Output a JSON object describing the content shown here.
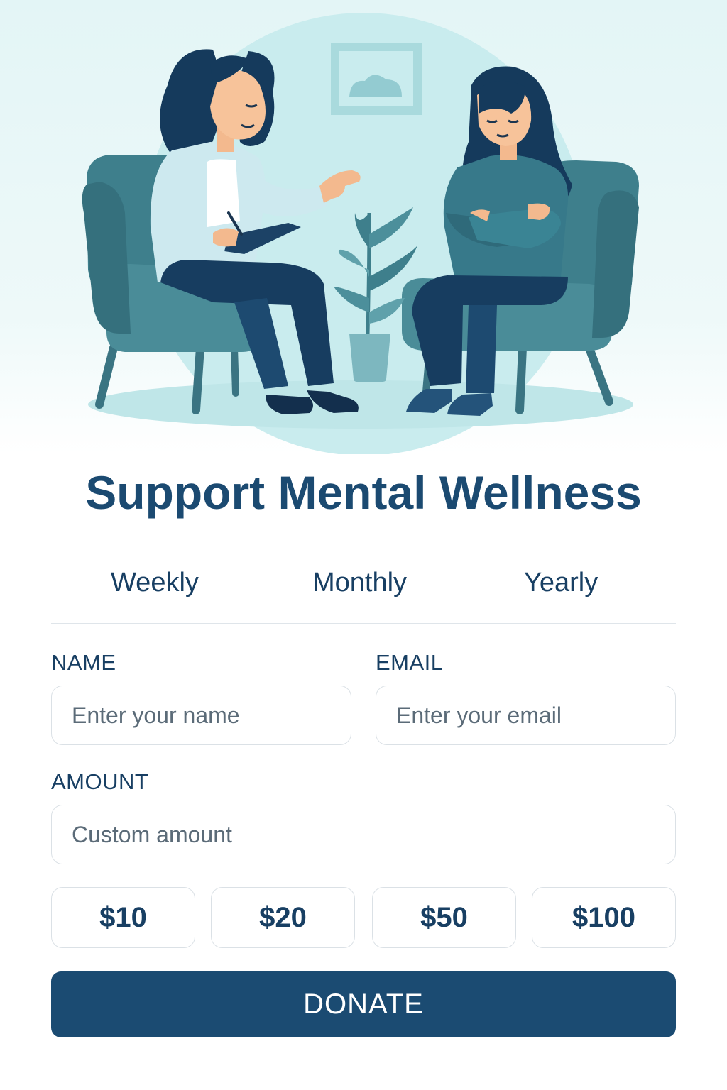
{
  "header": {
    "title": "Support Mental Wellness"
  },
  "frequency_tabs": [
    {
      "label": "Weekly"
    },
    {
      "label": "Monthly"
    },
    {
      "label": "Yearly"
    }
  ],
  "form": {
    "name": {
      "label": "NAME",
      "placeholder": "Enter your name",
      "value": ""
    },
    "email": {
      "label": "EMAIL",
      "placeholder": "Enter your email",
      "value": ""
    },
    "amount": {
      "label": "AMOUNT",
      "placeholder": "Custom amount",
      "value": ""
    },
    "presets": [
      {
        "label": "$10"
      },
      {
        "label": "$20"
      },
      {
        "label": "$50"
      },
      {
        "label": "$100"
      }
    ],
    "donate_label": "DONATE"
  },
  "colors": {
    "primary": "#1b4b72",
    "heading": "#1b4a71",
    "hero_background": "#e3f5f6",
    "chair": "#3e7f8c",
    "border": "#dbe1e6"
  },
  "illustration": {
    "icons": [
      "therapist-figure",
      "client-figure",
      "armchair",
      "potted-plant",
      "wall-frame"
    ]
  }
}
